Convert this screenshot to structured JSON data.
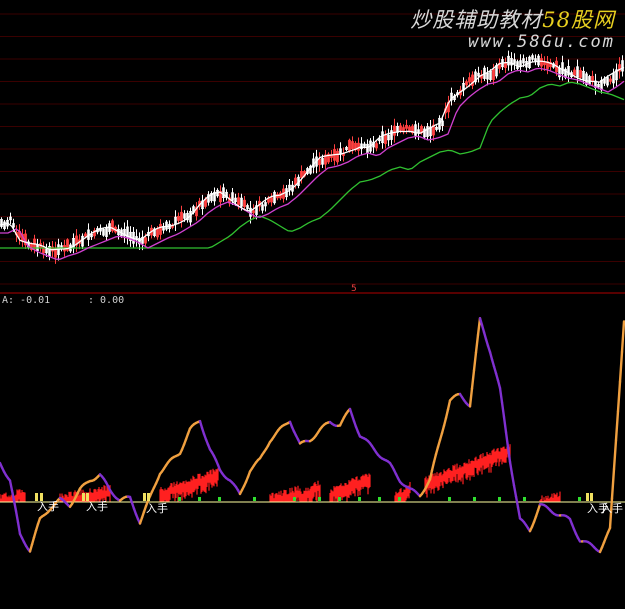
{
  "watermark": {
    "title_part1": "炒股辅助教材",
    "title_part2": "58股网",
    "url": "www.58Gu.com"
  },
  "indicator": {
    "readout_a": "A: -0.01",
    "readout_b": ": 0.00",
    "marker": "5",
    "buy_label": "入手",
    "buy_label_count": 5
  },
  "colors": {
    "background": "#000000",
    "grid": "#3a0000",
    "separator": "#b00000",
    "candle_up": "#ffffff",
    "candle_down": "#ff4040",
    "ma_short": "#ffffff",
    "ma_mid": "#d040d0",
    "ma_long": "#30c030",
    "osc_rising": "#f0a040",
    "osc_falling": "#8030d0",
    "histogram": "#ff2020",
    "baseline": "#ffffa0",
    "signal_dot": "#30e030",
    "buy_marker": "#f0e060"
  },
  "chart_data": [
    {
      "type": "line",
      "panel": "price",
      "grid": true,
      "series_styles": [
        "candlestick",
        "moving-average short",
        "moving-average mid",
        "moving-average long"
      ],
      "x": [
        0,
        10,
        20,
        30,
        40,
        50,
        60,
        70,
        80,
        90,
        100,
        110,
        120,
        130,
        140,
        150,
        160,
        170,
        180,
        190,
        200,
        210,
        220,
        230,
        240,
        250,
        260,
        270,
        280,
        290,
        300,
        310,
        320,
        330,
        340,
        350,
        360,
        370,
        380,
        390,
        400,
        410,
        420,
        430,
        440,
        450,
        460,
        470,
        480,
        490,
        500,
        510,
        520,
        530,
        540,
        550,
        560,
        570,
        580,
        590,
        600,
        610,
        620
      ],
      "close_series": [
        225,
        220,
        238,
        244,
        248,
        252,
        248,
        245,
        240,
        236,
        232,
        228,
        230,
        234,
        240,
        235,
        230,
        226,
        220,
        214,
        205,
        198,
        194,
        198,
        204,
        210,
        206,
        200,
        196,
        188,
        178,
        168,
        160,
        158,
        154,
        148,
        145,
        148,
        140,
        135,
        130,
        128,
        132,
        130,
        126,
        100,
        90,
        82,
        76,
        74,
        66,
        62,
        64,
        60,
        62,
        66,
        70,
        72,
        76,
        80,
        84,
        78,
        70
      ]
    },
    {
      "type": "line",
      "panel": "oscillator",
      "x": [
        0,
        10,
        20,
        30,
        40,
        50,
        60,
        70,
        80,
        90,
        100,
        110,
        120,
        130,
        140,
        150,
        160,
        170,
        180,
        190,
        200,
        210,
        220,
        230,
        240,
        250,
        260,
        270,
        280,
        290,
        300,
        310,
        320,
        330,
        340,
        350,
        360,
        370,
        380,
        390,
        400,
        410,
        420,
        430,
        440,
        450,
        460,
        470,
        480,
        490,
        500,
        510,
        520,
        530,
        540,
        550,
        560,
        570,
        580,
        590,
        600,
        610,
        620
      ],
      "osc_series": [
        463,
        480,
        535,
        550,
        520,
        508,
        500,
        505,
        490,
        480,
        475,
        490,
        500,
        498,
        522,
        498,
        472,
        462,
        452,
        430,
        420,
        450,
        470,
        480,
        495,
        470,
        460,
        440,
        430,
        420,
        445,
        440,
        430,
        422,
        425,
        410,
        435,
        445,
        455,
        465,
        480,
        490,
        495,
        480,
        440,
        400,
        395,
        405,
        320,
        350,
        390,
        460,
        520,
        530,
        505,
        510,
        515,
        520,
        540,
        545,
        550,
        530,
        380
      ],
      "histogram_note": "red fill between baseline and lower envelope"
    }
  ]
}
